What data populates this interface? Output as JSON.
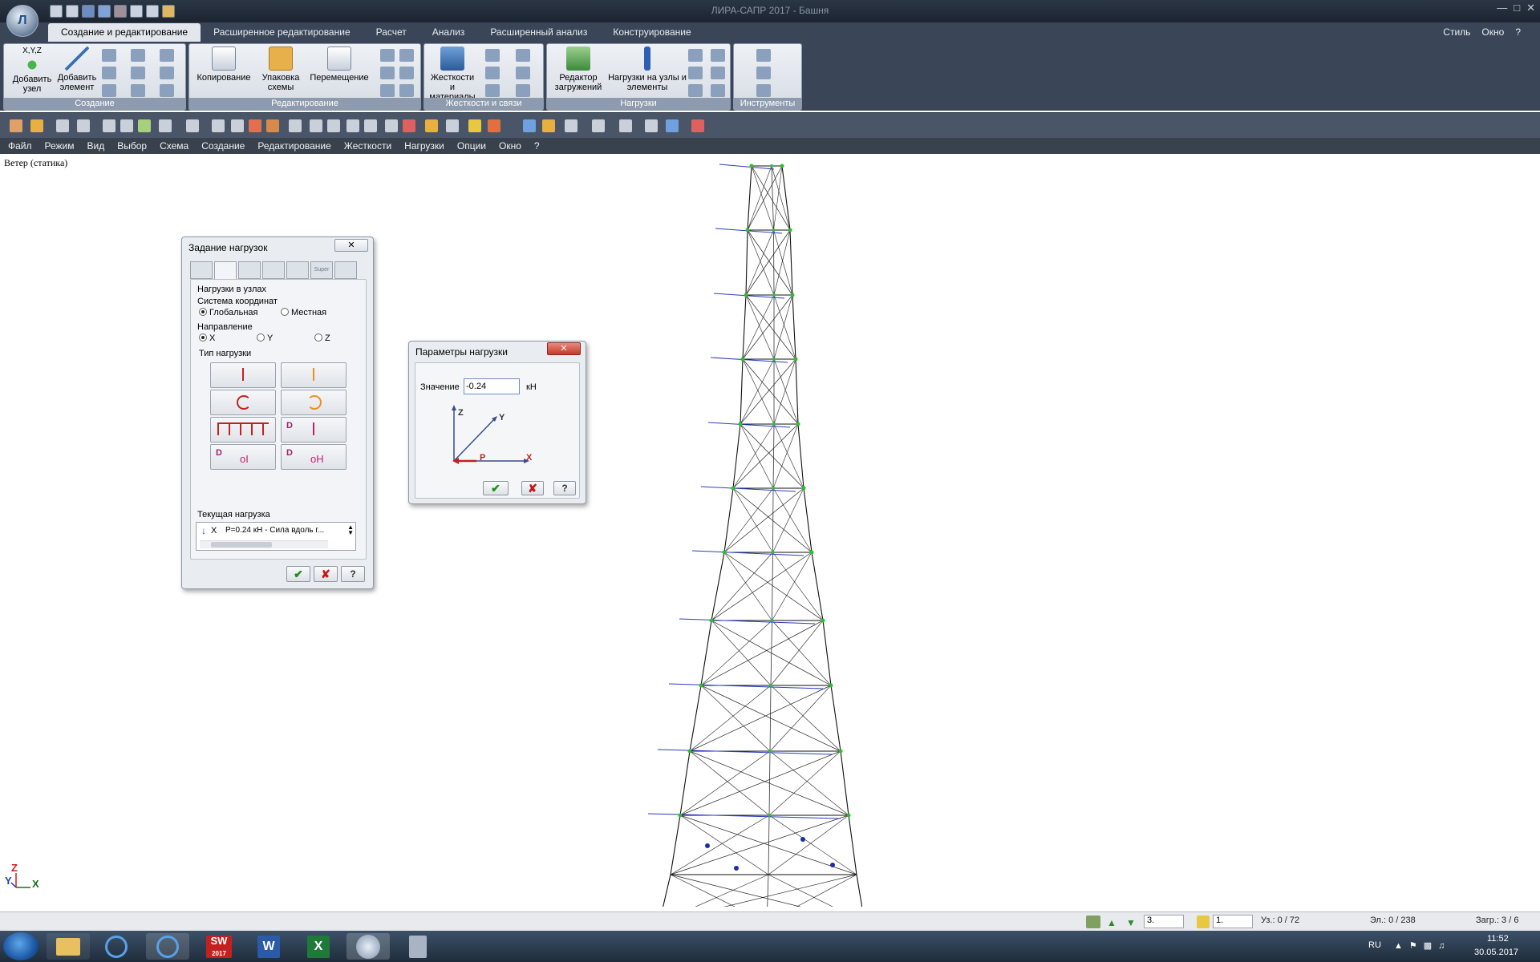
{
  "window": {
    "title": "ЛИРА-САПР 2017 - Башня"
  },
  "ribbon_tabs": [
    "Создание и редактирование",
    "Расширенное редактирование",
    "Расчет",
    "Анализ",
    "Расширенный анализ",
    "Конструирование"
  ],
  "top_right": {
    "style": "Стиль",
    "window": "Окно"
  },
  "ribbon": {
    "groups": {
      "create": "Создание",
      "edit": "Редактирование",
      "stiff": "Жесткости и связи",
      "loads": "Нагрузки",
      "tools": "Инструменты"
    },
    "buttons": {
      "add_node": "Добавить узел",
      "add_elem": "Добавить элемент",
      "copy": "Копирование",
      "pack": "Упаковка схемы",
      "move": "Перемещение",
      "stiff_mat": "Жесткости и материалы",
      "load_editor": "Редактор загружений",
      "loads_nodes": "Нагрузки на узлы и элементы"
    },
    "xyz_label": "X,Y,Z"
  },
  "menu": [
    "Файл",
    "Режим",
    "Вид",
    "Выбор",
    "Схема",
    "Создание",
    "Редактирование",
    "Жесткости",
    "Нагрузки",
    "Опции",
    "Окно",
    "?"
  ],
  "workspace": {
    "caption": "Ветер (статика)"
  },
  "load_dialog": {
    "title": "Задание нагрузок",
    "super_tab": "Super",
    "section": "Нагрузки в узлах",
    "coord_system": "Система координат",
    "global": "Глобальная",
    "local": "Местная",
    "direction": "Направление",
    "dir_x": "X",
    "dir_y": "Y",
    "dir_z": "Z",
    "load_type": "Тип нагрузки",
    "current_load": "Текущая нагрузка",
    "current_value": "P=0.24 кН - Сила вдоль г...",
    "current_axis": "X"
  },
  "param_dialog": {
    "title": "Параметры  нагрузки",
    "value_label": "Значение",
    "value": "-0.24",
    "unit": "кН",
    "axis_z": "Z",
    "axis_y": "Y",
    "axis_x": "X",
    "axis_p": "P"
  },
  "axis_triad": {
    "z": "Z",
    "y": "Y",
    "x": "X"
  },
  "status": {
    "combo1": "3.",
    "combo2": "1.",
    "nodes": "Уз.: 0 / 72",
    "elements": "Эл.: 0 / 238",
    "load": "Загр.: 3 / 6"
  },
  "taskbar": {
    "lang": "RU",
    "time": "11:52",
    "date": "30.05.2017",
    "sw_year": "2017"
  }
}
